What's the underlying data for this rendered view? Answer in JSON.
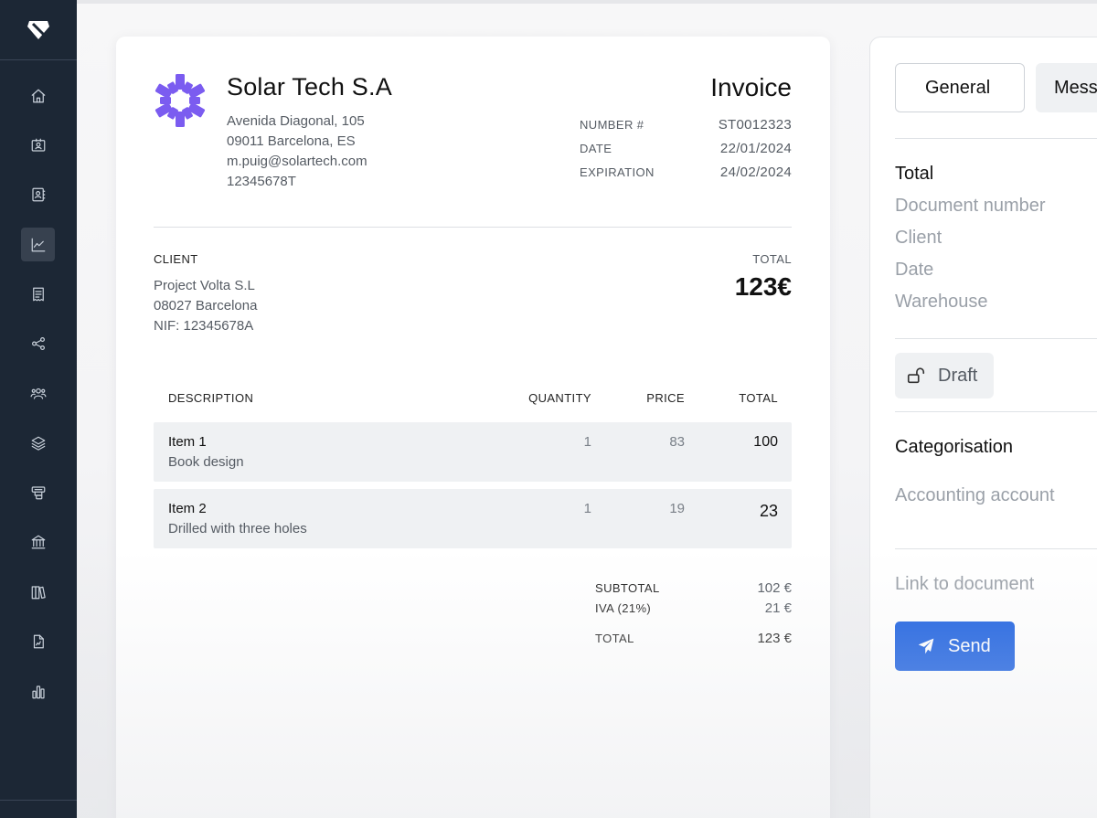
{
  "colors": {
    "sidebar_bg": "#1c2735",
    "accent_blue": "#1a5fe0",
    "logo_purple": "#7b5cf0",
    "row_bg": "#eff1f3"
  },
  "sidebar": {
    "logo_icon": "diamond-logo-icon",
    "items": [
      {
        "icon": "home-icon"
      },
      {
        "icon": "contact-card-icon"
      },
      {
        "icon": "address-book-icon"
      },
      {
        "icon": "chart-line-icon",
        "active": true
      },
      {
        "icon": "receipt-icon"
      },
      {
        "icon": "share-nodes-icon"
      },
      {
        "icon": "users-icon"
      },
      {
        "icon": "layers-icon"
      },
      {
        "icon": "cash-register-icon"
      },
      {
        "icon": "bank-icon"
      },
      {
        "icon": "books-icon"
      },
      {
        "icon": "report-file-icon"
      },
      {
        "icon": "bar-chart-icon"
      }
    ]
  },
  "invoice": {
    "company_name": "Solar Tech S.A",
    "company_lines": [
      "Avenida Diagonal, 105",
      "09011 Barcelona, ES",
      "m.puig@solartech.com",
      "12345678T"
    ],
    "title": "Invoice",
    "meta": [
      {
        "label": "NUMBER #",
        "value": "ST0012323"
      },
      {
        "label": "DATE",
        "value": "22/01/2024"
      },
      {
        "label": "EXPIRATION",
        "value": "24/02/2024"
      }
    ],
    "client_label": "CLIENT",
    "client_lines": [
      "Project Volta S.L",
      "08027 Barcelona",
      "NIF: 12345678A"
    ],
    "total_label": "TOTAL",
    "total_amount": "123€",
    "table": {
      "headers": {
        "description": "DESCRIPTION",
        "quantity": "QUANTITY",
        "price": "PRICE",
        "total": "TOTAL"
      },
      "rows": [
        {
          "name": "Item 1",
          "desc": "Book design",
          "qty": "1",
          "price": "83",
          "total": "100"
        },
        {
          "name": "Item 2",
          "desc": "Drilled with three holes",
          "qty": "1",
          "price": "19",
          "total": "23"
        }
      ]
    },
    "summary": [
      {
        "label": "SUBTOTAL",
        "value": "102 €"
      },
      {
        "label": "IVA (21%)",
        "value": "21 €"
      },
      {
        "label": "TOTAL",
        "value": "123 €"
      }
    ]
  },
  "panel": {
    "tabs": {
      "general": "General",
      "messages": "Mess"
    },
    "total_heading": "Total",
    "total_items": [
      "Document number",
      "Client",
      "Date",
      "Warehouse"
    ],
    "draft_label": "Draft",
    "categorisation_heading": "Categorisation",
    "accounting_account": "Accounting account",
    "link_to_document": "Link to document",
    "send_label": "Send"
  }
}
